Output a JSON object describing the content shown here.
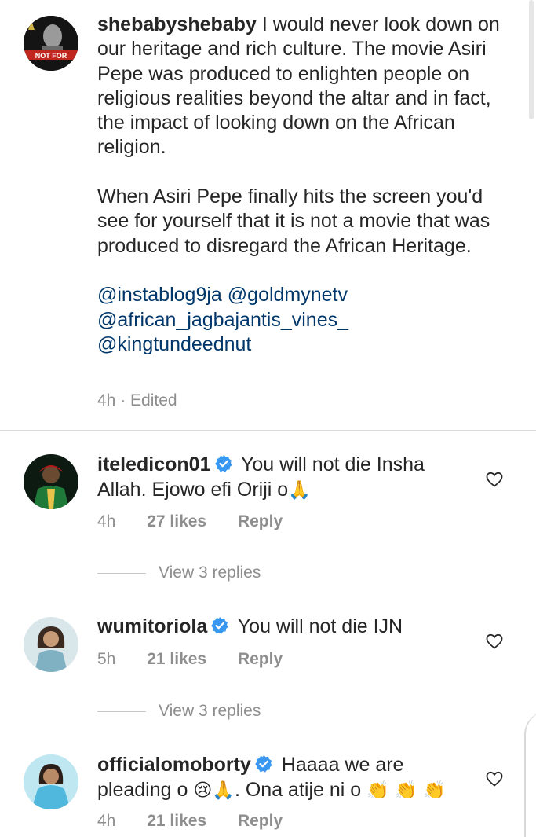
{
  "caption": {
    "username": "shebabyshebaby",
    "para1": "I would never look down on our heritage and rich culture. The movie Asiri Pepe was produced to enlighten people on religious realities beyond the altar and in fact, the impact of looking down on the African religion.",
    "para2": "When Asiri Pepe finally hits the screen you'd see for yourself that it is not a movie that was produced to disregard the African Heritage.",
    "mentions": [
      "@instablog9ja",
      "@goldmynetv",
      "@african_jagbajantis_vines_",
      "@kingtundeednut"
    ],
    "time": "4h",
    "edited": "· Edited",
    "avatar_text": "NOT FOR"
  },
  "comments": [
    {
      "username": "iteledicon01",
      "text": "You will not die Insha Allah. Ejowo efi Oriji o",
      "emoji": "🙏",
      "time": "4h",
      "likes": "27 likes",
      "reply": "Reply",
      "view_replies": "View 3 replies"
    },
    {
      "username": "wumitoriola",
      "text": "You will not die IJN",
      "time": "5h",
      "likes": "21 likes",
      "reply": "Reply",
      "view_replies": "View 3 replies"
    },
    {
      "username": "officialomoborty",
      "text_a": "Haaaa we are pleading o",
      "emoji_a": "😢🙏",
      "text_b": ". Ona atije ni o",
      "emoji_b": "👏 👏 👏",
      "time": "4h",
      "likes": "21 likes",
      "reply": "Reply"
    }
  ],
  "colors": {
    "text": "#262626",
    "secondary": "#8e8e8e",
    "mention": "#00376b",
    "verified": "#3897f0"
  },
  "icons": [
    "verified-badge-icon",
    "heart-icon"
  ]
}
